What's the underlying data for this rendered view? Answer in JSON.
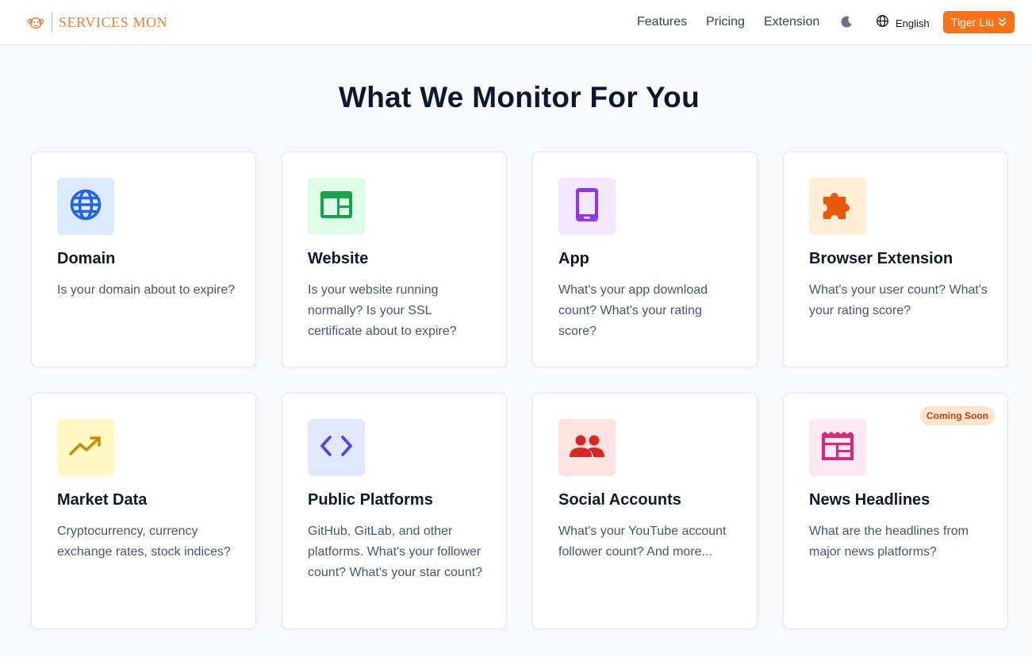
{
  "header": {
    "logo_text": "SERVICES MON",
    "nav": {
      "features": "Features",
      "pricing": "Pricing",
      "extension": "Extension"
    },
    "language": "English",
    "user": "Tiger Liu"
  },
  "main": {
    "title": "What We Monitor For You",
    "cards": [
      {
        "title": "Domain",
        "description": "Is your domain about to expire?",
        "icon": "globe-icon",
        "icon_color": "#2563eb",
        "icon_bg": "#dbeafe"
      },
      {
        "title": "Website",
        "description": "Is your website running normally? Is your SSL certificate about to expire?",
        "icon": "website-icon",
        "icon_color": "#16a34a",
        "icon_bg": "#dcfce7"
      },
      {
        "title": "App",
        "description": "What's your app download count? What's your rating score?",
        "icon": "phone-icon",
        "icon_color": "#9333ea",
        "icon_bg": "#f3e8ff"
      },
      {
        "title": "Browser Extension",
        "description": "What's your user count? What's your rating score?",
        "icon": "puzzle-icon",
        "icon_color": "#ea580c",
        "icon_bg": "#ffedd5"
      },
      {
        "title": "Market Data",
        "description": "Cryptocurrency, currency exchange rates, stock indices?",
        "icon": "trending-up-icon",
        "icon_color": "#ca8a04",
        "icon_bg": "#fef9c3"
      },
      {
        "title": "Public Platforms",
        "description": "GitHub, GitLab, and other platforms. What's your follower count? What's your star count?",
        "icon": "code-icon",
        "icon_color": "#4f46e5",
        "icon_bg": "#e0e7ff"
      },
      {
        "title": "Social Accounts",
        "description": "What's your YouTube account follower count? And more...",
        "icon": "people-icon",
        "icon_color": "#dc2626",
        "icon_bg": "#fee2e2"
      },
      {
        "title": "News Headlines",
        "description": "What are the headlines from major news platforms?",
        "icon": "newspaper-icon",
        "icon_color": "#db2777",
        "icon_bg": "#fce7f3",
        "badge": "Coming Soon"
      }
    ]
  },
  "colors": {
    "accent": "#f97316",
    "logo": "#e8813a"
  }
}
